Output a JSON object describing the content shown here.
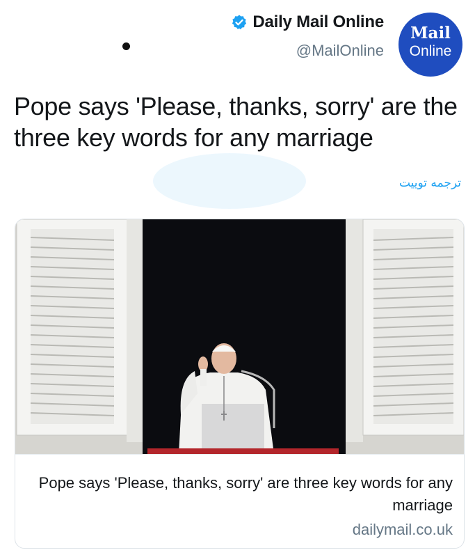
{
  "author": {
    "display_name": "Daily Mail Online",
    "handle": "@MailOnline",
    "verified": true,
    "avatar_line1": "Mail",
    "avatar_line2": "Online",
    "avatar_color": "#1f4dbf"
  },
  "tweet": {
    "text": "Pope says 'Please, thanks, sorry' are the three key words for any marriage",
    "translate_label": "ترجمه توییت"
  },
  "card": {
    "title": "Pope says 'Please, thanks, sorry' are three key words for any marriage",
    "domain": "dailymail.co.uk"
  },
  "colors": {
    "link": "#1da1f2",
    "secondary_text": "#657786",
    "verified": "#1da1f2"
  }
}
